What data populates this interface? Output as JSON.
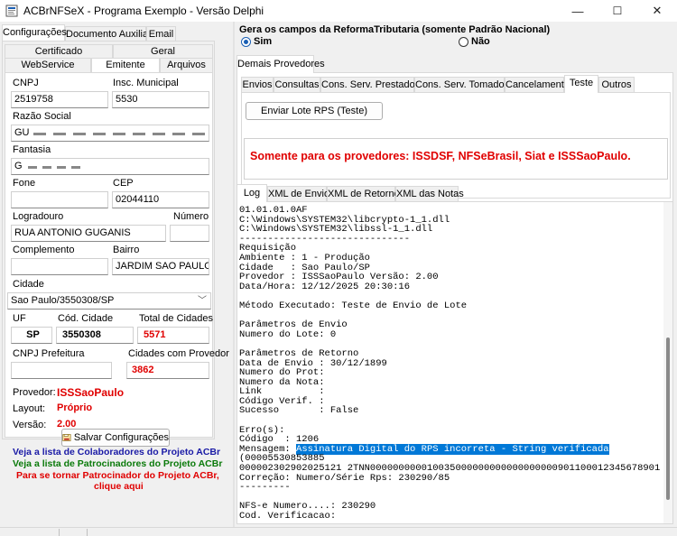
{
  "window": {
    "title": "ACBrNFSeX - Programa Exemplo - Versão Delphi",
    "min": "—",
    "max": "☐",
    "close": "✕"
  },
  "left": {
    "tabs_top": [
      "Configurações",
      "Documento Auxiliar",
      "Email"
    ],
    "tabs_row1": [
      "Certificado",
      "Geral"
    ],
    "tabs_row2": [
      "WebService",
      "Emitente",
      "Arquivos"
    ],
    "fields": {
      "cnpj_label": "CNPJ",
      "cnpj": "2519758",
      "im_label": "Insc. Municipal",
      "im": "5530",
      "razao_label": "Razão Social",
      "razao": "GU",
      "fantasia_label": "Fantasia",
      "fantasia": "G",
      "fone_label": "Fone",
      "fone": "",
      "cep_label": "CEP",
      "cep": "02044110",
      "logradouro_label": "Logradouro",
      "logradouro": "RUA ANTONIO GUGANIS",
      "numero_label": "Número",
      "numero": "",
      "complemento_label": "Complemento",
      "complemento": "",
      "bairro_label": "Bairro",
      "bairro": "JARDIM SAO PAULO",
      "cidade_label": "Cidade",
      "cidade": "Sao Paulo/3550308/SP",
      "uf_label": "UF",
      "uf": "SP",
      "cod_cidade_label": "Cód. Cidade",
      "cod_cidade": "3550308",
      "total_cidades_label": "Total de Cidades",
      "total_cidades": "5571",
      "cnpj_pref_label": "CNPJ Prefeitura",
      "cnpj_pref": "",
      "cid_prov_label": "Cidades com Provedor",
      "cid_prov": "3862"
    },
    "provedor_label": "Provedor:",
    "provedor": "ISSSaoPaulo",
    "layout_label": "Layout:",
    "layout": "Próprio",
    "versao_label": "Versão:",
    "versao": "2.00",
    "save_button": "Salvar Configurações",
    "link_colab": "Veja a lista de Colaboradores do Projeto ACBr",
    "link_patro": "Veja a lista de Patrocinadores do Projeto ACBr",
    "link_tornar1": "Para se tornar Patrocinador do Projeto ACBr,",
    "link_tornar2": "clique aqui"
  },
  "right": {
    "reforma_title": "Gera os campos da ReformaTributaria (somente Padrão Nacional)",
    "sim": "Sim",
    "nao": "Não",
    "demais_tab": "Demais Provedores",
    "op_tabs": [
      "Envios",
      "Consultas",
      "Cons. Serv. Prestados",
      "Cons. Serv. Tomados",
      "Cancelamento",
      "Teste",
      "Outros"
    ],
    "enviar_button": "Enviar Lote RPS (Teste)",
    "warning": "Somente para os provedores: ISSDSF, NFSeBrasil, Siat e ISSSaoPaulo.",
    "log_tabs": [
      "Log",
      "XML de Envio",
      "XML de Retorno",
      "XML das Notas"
    ],
    "log_before": "01.01.01.0AF\nC:\\Windows\\SYSTEM32\\libcrypto-1_1.dll\nC:\\Windows\\SYSTEM32\\libssl-1_1.dll\n------------------------------\nRequisição\nAmbiente : 1 - Produção\nCidade   : Sao Paulo/SP\nProvedor : ISSSaoPaulo Versão: 2.00\nData/Hora: 12/12/2025 20:30:16\n\nMétodo Executado: Teste de Envio de Lote\n\nParâmetros de Envio\nNumero do Lote: 0\n\nParâmetros de Retorno\nData de Envio : 30/12/1899\nNumero do Prot:\nNumero da Nota:\nLink          :\nCódigo Verif. :\nSucesso       : False\n\nErro(s):\nCódigo  : 1206\nMensagem: ",
    "log_selected": "Assinatura Digital do RPS incorreta - String verificada",
    "log_after": "\n(00005530853885\n000002302902025121 2TNN000000000010035000000000000000000901100012345678901)\nCorreção: Numero/Série Rps: 230290/85\n---------\n\nNFS-e Numero....: 230290\nCod. Verificacao:\nPrestador.......: GUARDED PLACE SEGURANCA  VIGILANCIA LTDA\nTomador.........: INSCRICAO DE TESTE E TESTE"
  }
}
